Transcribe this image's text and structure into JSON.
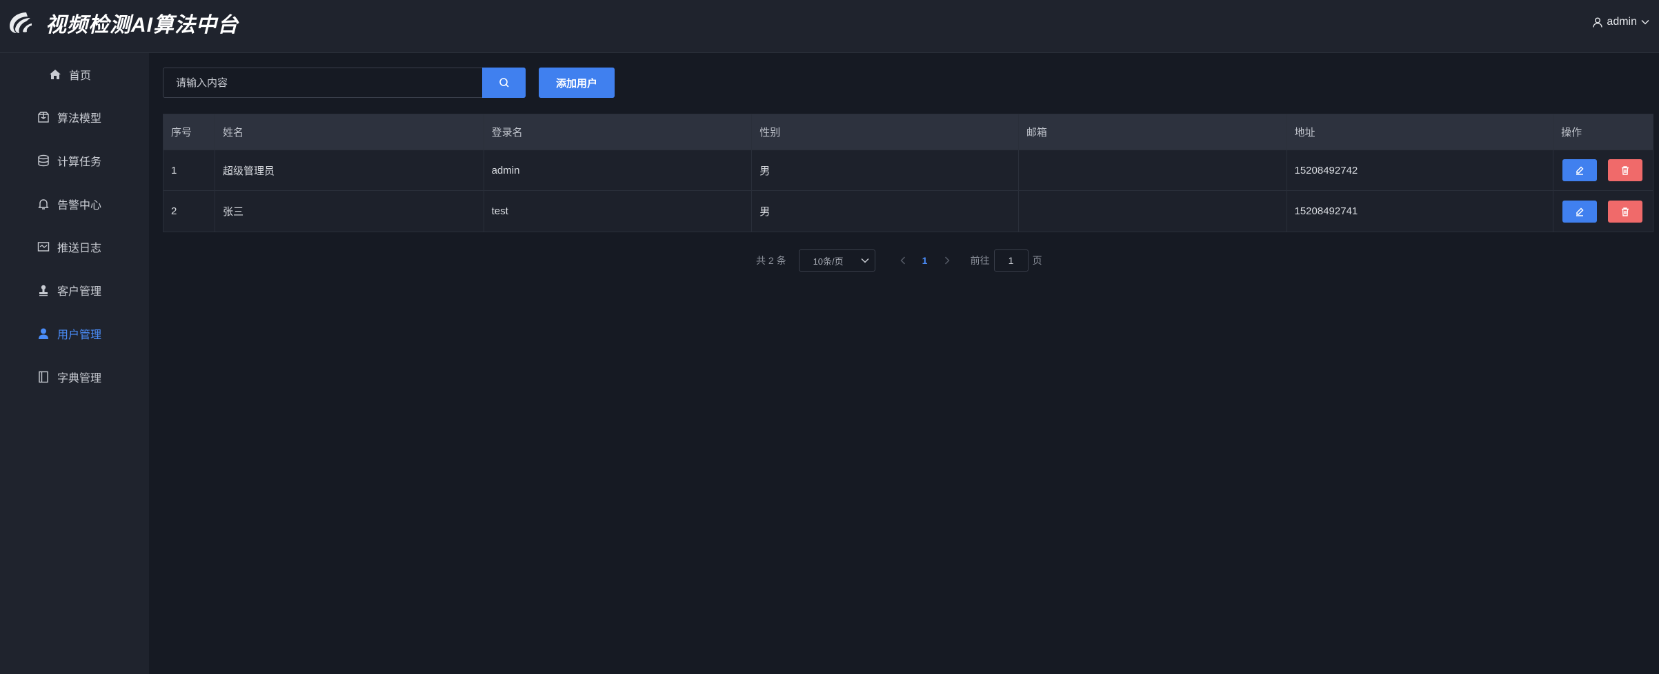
{
  "header": {
    "app_title": "视频检测AI算法中台",
    "user_name": "admin"
  },
  "sidebar": {
    "items": [
      {
        "label": "首页",
        "icon": "home-icon"
      },
      {
        "label": "算法模型",
        "icon": "package-icon"
      },
      {
        "label": "计算任务",
        "icon": "database-icon"
      },
      {
        "label": "告警中心",
        "icon": "bell-icon"
      },
      {
        "label": "推送日志",
        "icon": "message-icon"
      },
      {
        "label": "客户管理",
        "icon": "stamp-icon"
      },
      {
        "label": "用户管理",
        "icon": "user-icon",
        "active": true
      },
      {
        "label": "字典管理",
        "icon": "notebook-icon"
      }
    ]
  },
  "toolbar": {
    "search_placeholder": "请输入内容",
    "add_label": "添加用户"
  },
  "table": {
    "columns": [
      "序号",
      "姓名",
      "登录名",
      "性别",
      "邮箱",
      "地址",
      "操作"
    ],
    "rows": [
      {
        "index": "1",
        "name": "超级管理员",
        "login": "admin",
        "gender": "男",
        "email": "",
        "address": "15208492742"
      },
      {
        "index": "2",
        "name": "张三",
        "login": "test",
        "gender": "男",
        "email": "",
        "address": "15208492741"
      }
    ]
  },
  "pagination": {
    "total_text": "共 2 条",
    "page_size": "10条/页",
    "current_page": "1",
    "goto_label": "前往",
    "goto_value": "1",
    "page_suffix": "页"
  },
  "colors": {
    "accent": "#4080ef",
    "danger": "#f06a6a",
    "background": "#161a23",
    "panel": "#1f232d"
  }
}
